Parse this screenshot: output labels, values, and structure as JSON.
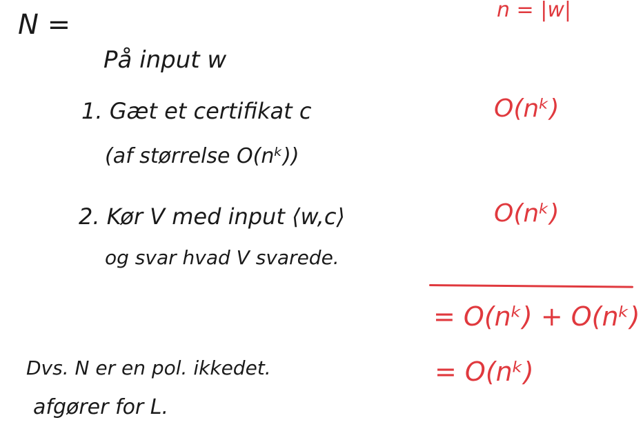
{
  "notes": {
    "n_def": "N =",
    "input_line": "På input w",
    "step1_line1": "1. Gæt et certifikat c",
    "step1_line2": "(af størrelse O(nᵏ))",
    "step2_line1": "2. Kør V med input ⟨w,c⟩",
    "step2_line2": "og svar hvad V svarede.",
    "conclusion_line1": "Dvs. N er en pol. ikkedet.",
    "conclusion_line2": "afgører for L."
  },
  "margin": {
    "n_size": "n = |w|",
    "cost_step1": "O(nᵏ)",
    "cost_step2": "O(nᵏ)",
    "sum": "= O(nᵏ) + O(nᵏ)",
    "result": "= O(nᵏ)"
  },
  "colors": {
    "ink": "#1a1a1a",
    "red_ink": "#e0393e",
    "background": "#ffffff"
  }
}
